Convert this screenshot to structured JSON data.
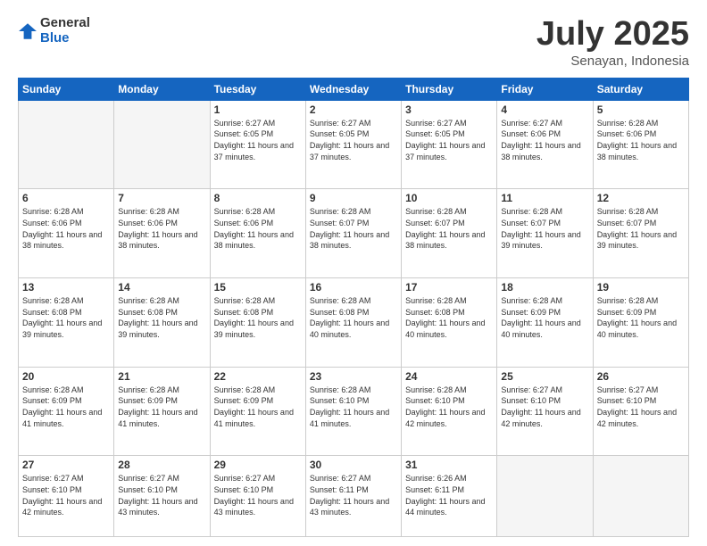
{
  "logo": {
    "general": "General",
    "blue": "Blue"
  },
  "header": {
    "month": "July 2025",
    "location": "Senayan, Indonesia"
  },
  "weekdays": [
    "Sunday",
    "Monday",
    "Tuesday",
    "Wednesday",
    "Thursday",
    "Friday",
    "Saturday"
  ],
  "weeks": [
    [
      {
        "day": "",
        "info": ""
      },
      {
        "day": "",
        "info": ""
      },
      {
        "day": "1",
        "info": "Sunrise: 6:27 AM\nSunset: 6:05 PM\nDaylight: 11 hours and 37 minutes."
      },
      {
        "day": "2",
        "info": "Sunrise: 6:27 AM\nSunset: 6:05 PM\nDaylight: 11 hours and 37 minutes."
      },
      {
        "day": "3",
        "info": "Sunrise: 6:27 AM\nSunset: 6:05 PM\nDaylight: 11 hours and 37 minutes."
      },
      {
        "day": "4",
        "info": "Sunrise: 6:27 AM\nSunset: 6:06 PM\nDaylight: 11 hours and 38 minutes."
      },
      {
        "day": "5",
        "info": "Sunrise: 6:28 AM\nSunset: 6:06 PM\nDaylight: 11 hours and 38 minutes."
      }
    ],
    [
      {
        "day": "6",
        "info": "Sunrise: 6:28 AM\nSunset: 6:06 PM\nDaylight: 11 hours and 38 minutes."
      },
      {
        "day": "7",
        "info": "Sunrise: 6:28 AM\nSunset: 6:06 PM\nDaylight: 11 hours and 38 minutes."
      },
      {
        "day": "8",
        "info": "Sunrise: 6:28 AM\nSunset: 6:06 PM\nDaylight: 11 hours and 38 minutes."
      },
      {
        "day": "9",
        "info": "Sunrise: 6:28 AM\nSunset: 6:07 PM\nDaylight: 11 hours and 38 minutes."
      },
      {
        "day": "10",
        "info": "Sunrise: 6:28 AM\nSunset: 6:07 PM\nDaylight: 11 hours and 38 minutes."
      },
      {
        "day": "11",
        "info": "Sunrise: 6:28 AM\nSunset: 6:07 PM\nDaylight: 11 hours and 39 minutes."
      },
      {
        "day": "12",
        "info": "Sunrise: 6:28 AM\nSunset: 6:07 PM\nDaylight: 11 hours and 39 minutes."
      }
    ],
    [
      {
        "day": "13",
        "info": "Sunrise: 6:28 AM\nSunset: 6:08 PM\nDaylight: 11 hours and 39 minutes."
      },
      {
        "day": "14",
        "info": "Sunrise: 6:28 AM\nSunset: 6:08 PM\nDaylight: 11 hours and 39 minutes."
      },
      {
        "day": "15",
        "info": "Sunrise: 6:28 AM\nSunset: 6:08 PM\nDaylight: 11 hours and 39 minutes."
      },
      {
        "day": "16",
        "info": "Sunrise: 6:28 AM\nSunset: 6:08 PM\nDaylight: 11 hours and 40 minutes."
      },
      {
        "day": "17",
        "info": "Sunrise: 6:28 AM\nSunset: 6:08 PM\nDaylight: 11 hours and 40 minutes."
      },
      {
        "day": "18",
        "info": "Sunrise: 6:28 AM\nSunset: 6:09 PM\nDaylight: 11 hours and 40 minutes."
      },
      {
        "day": "19",
        "info": "Sunrise: 6:28 AM\nSunset: 6:09 PM\nDaylight: 11 hours and 40 minutes."
      }
    ],
    [
      {
        "day": "20",
        "info": "Sunrise: 6:28 AM\nSunset: 6:09 PM\nDaylight: 11 hours and 41 minutes."
      },
      {
        "day": "21",
        "info": "Sunrise: 6:28 AM\nSunset: 6:09 PM\nDaylight: 11 hours and 41 minutes."
      },
      {
        "day": "22",
        "info": "Sunrise: 6:28 AM\nSunset: 6:09 PM\nDaylight: 11 hours and 41 minutes."
      },
      {
        "day": "23",
        "info": "Sunrise: 6:28 AM\nSunset: 6:10 PM\nDaylight: 11 hours and 41 minutes."
      },
      {
        "day": "24",
        "info": "Sunrise: 6:28 AM\nSunset: 6:10 PM\nDaylight: 11 hours and 42 minutes."
      },
      {
        "day": "25",
        "info": "Sunrise: 6:27 AM\nSunset: 6:10 PM\nDaylight: 11 hours and 42 minutes."
      },
      {
        "day": "26",
        "info": "Sunrise: 6:27 AM\nSunset: 6:10 PM\nDaylight: 11 hours and 42 minutes."
      }
    ],
    [
      {
        "day": "27",
        "info": "Sunrise: 6:27 AM\nSunset: 6:10 PM\nDaylight: 11 hours and 42 minutes."
      },
      {
        "day": "28",
        "info": "Sunrise: 6:27 AM\nSunset: 6:10 PM\nDaylight: 11 hours and 43 minutes."
      },
      {
        "day": "29",
        "info": "Sunrise: 6:27 AM\nSunset: 6:10 PM\nDaylight: 11 hours and 43 minutes."
      },
      {
        "day": "30",
        "info": "Sunrise: 6:27 AM\nSunset: 6:11 PM\nDaylight: 11 hours and 43 minutes."
      },
      {
        "day": "31",
        "info": "Sunrise: 6:26 AM\nSunset: 6:11 PM\nDaylight: 11 hours and 44 minutes."
      },
      {
        "day": "",
        "info": ""
      },
      {
        "day": "",
        "info": ""
      }
    ]
  ]
}
